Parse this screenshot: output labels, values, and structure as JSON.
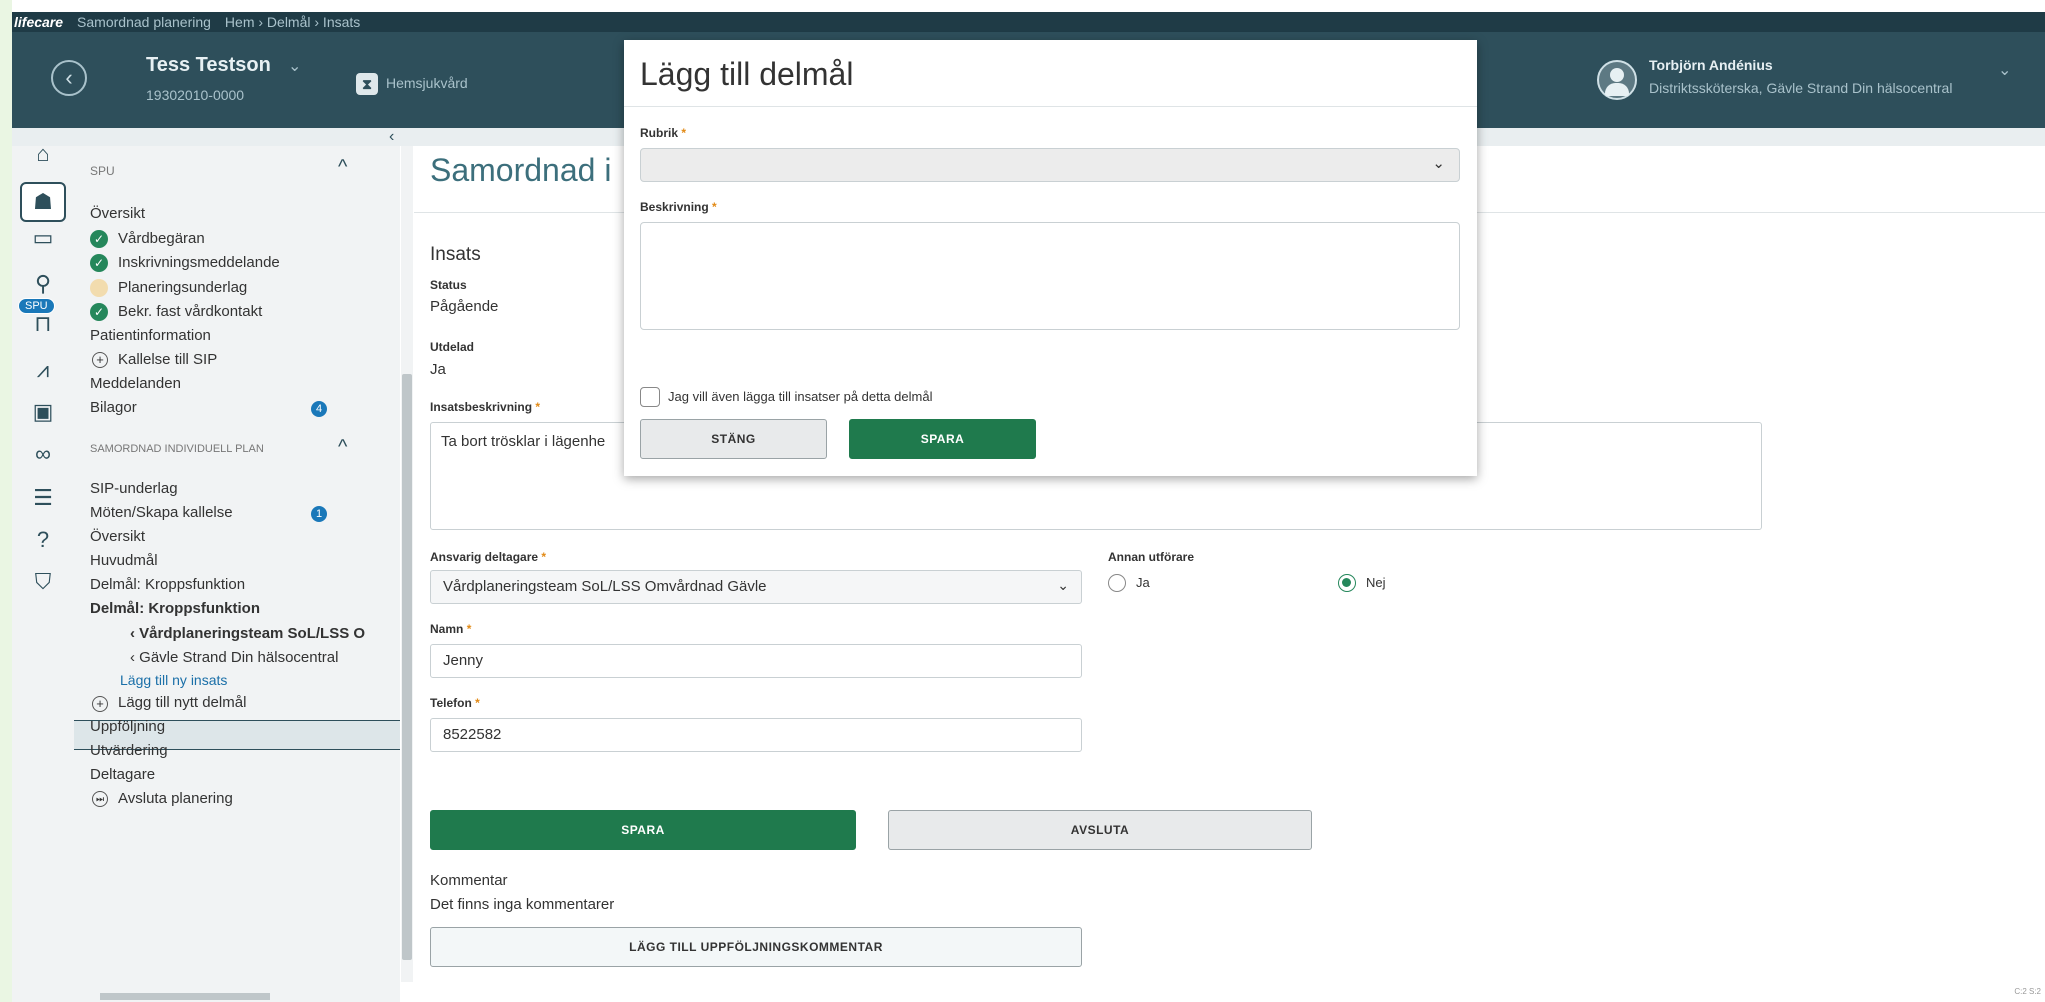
{
  "topbar": {
    "brand": "lifecare",
    "module": "Samordnad planering",
    "breadcrumb": "Hem › Delmål › Insats"
  },
  "patient": {
    "name": "Tess Testson",
    "personnummer": "19302010-0000",
    "unit": "Hemsjukvård"
  },
  "user": {
    "name": "Torbjörn Andénius",
    "role": "Distriktssköterska, Gävle Strand Din hälsocentral"
  },
  "rail": {
    "spu_badge": "SPU"
  },
  "sidebar": {
    "sections": [
      {
        "label": "SPU"
      },
      {
        "label": "SAMORDNAD INDIVIDUELL PLAN"
      }
    ],
    "items": [
      {
        "label": "Översikt"
      },
      {
        "label": "Vårdbegäran",
        "status": "done"
      },
      {
        "label": "Inskrivningsmeddelande",
        "status": "done"
      },
      {
        "label": "Planeringsunderlag",
        "status": "pending"
      },
      {
        "label": "Bekr. fast vårdkontakt",
        "status": "done"
      },
      {
        "label": "Patientinformation"
      },
      {
        "label": "Kallelse till SIP"
      },
      {
        "label": "Meddelanden"
      },
      {
        "label": "Bilagor",
        "count": "4"
      },
      {
        "label": "SIP-underlag"
      },
      {
        "label": "Möten/Skapa kallelse",
        "count": "1"
      },
      {
        "label": "Översikt"
      },
      {
        "label": "Huvudmål"
      },
      {
        "label": "Delmål: Kroppsfunktion"
      },
      {
        "label": "Delmål: Kroppsfunktion"
      },
      {
        "label": "Vårdplaneringsteam SoL/LSS O"
      },
      {
        "label": "Gävle Strand Din hälsocentral"
      },
      {
        "label": "Lägg till ny insats"
      },
      {
        "label": "Lägg till nytt delmål"
      },
      {
        "label": "Uppföljning"
      },
      {
        "label": "Utvärdering"
      },
      {
        "label": "Deltagare"
      },
      {
        "label": "Avsluta planering"
      }
    ]
  },
  "main": {
    "title": "Samordnad i",
    "section": "Insats",
    "status_label": "Status",
    "status_value": "Pågående",
    "utdelad_label": "Utdelad",
    "utdelad_value": "Ja",
    "insatsbeskrivning_label": "Insatsbeskrivning",
    "insatsbeskrivning_value": "Ta bort trösklar i lägenhe",
    "ansvarig_label": "Ansvarig deltagare",
    "ansvarig_value": "Vårdplaneringsteam SoL/LSS Omvårdnad Gävle",
    "annan_label": "Annan utförare",
    "annan_ja": "Ja",
    "annan_nej": "Nej",
    "annan_selected": "Nej",
    "namn_label": "Namn",
    "namn_value": "Jenny",
    "telefon_label": "Telefon",
    "telefon_value": "8522582",
    "spara": "SPARA",
    "avsluta": "AVSLUTA",
    "kommentar_title": "Kommentar",
    "kommentar_empty": "Det finns inga kommentarer",
    "add_comment": "LÄGG TILL UPPFÖLJNINGSKOMMENTAR",
    "corner_text": "C:2 S:2"
  },
  "modal": {
    "title": "Lägg till delmål",
    "rubrik_label": "Rubrik",
    "rubrik_value": "",
    "beskrivning_label": "Beskrivning",
    "beskrivning_value": "",
    "checkbox_label": "Jag vill även lägga till insatser på detta delmål",
    "checkbox_checked": false,
    "close": "STÄNG",
    "save": "SPARA"
  },
  "required_mark": "*",
  "colors": {
    "header": "#2e4f5b",
    "topbar": "#1f3b46",
    "primary": "#1f7a4d",
    "accent": "#1a78b9",
    "title": "#3c6f7c"
  }
}
